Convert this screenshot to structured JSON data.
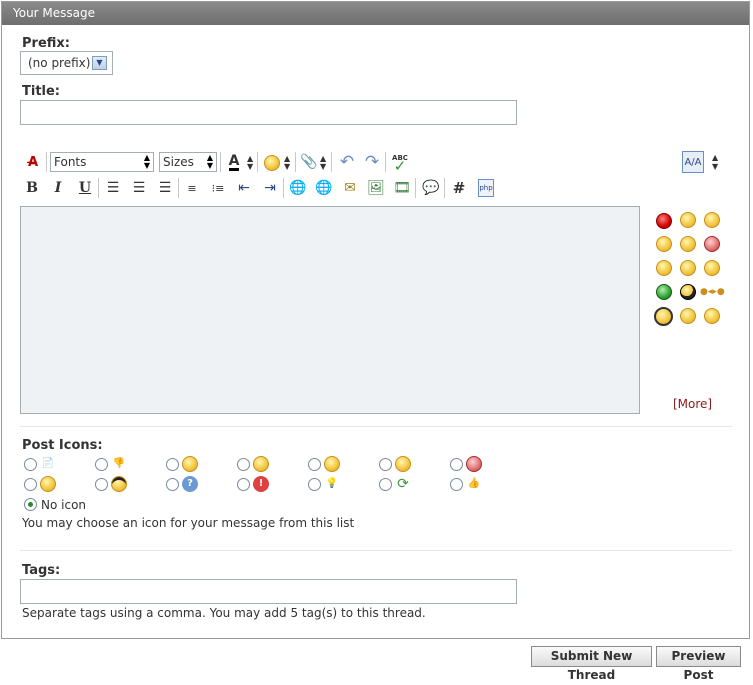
{
  "panel": {
    "title": "Your Message"
  },
  "form": {
    "prefix_label": "Prefix:",
    "prefix_value": "(no prefix)",
    "title_label": "Title:",
    "title_value": ""
  },
  "toolbar": {
    "font_select": "Fonts",
    "size_select": "Sizes",
    "bold": "B",
    "italic": "I",
    "underline": "U",
    "code": "#",
    "php": "php",
    "spell": "ABC",
    "switch_mode": "A/A"
  },
  "smilies": {
    "more_link": "[More]"
  },
  "post_icons": {
    "label": "Post Icons:",
    "no_icon": "No icon",
    "help": "You may choose an icon for your message from this list"
  },
  "tags": {
    "label": "Tags:",
    "value": "",
    "help": "Separate tags using a comma. You may add 5 tag(s) to this thread."
  },
  "buttons": {
    "submit": "Submit New Thread",
    "preview": "Preview Post"
  },
  "colors": {
    "header_bg": "#777777",
    "editor_bg": "#eef2f4",
    "more_link": "#8a1c1c"
  }
}
